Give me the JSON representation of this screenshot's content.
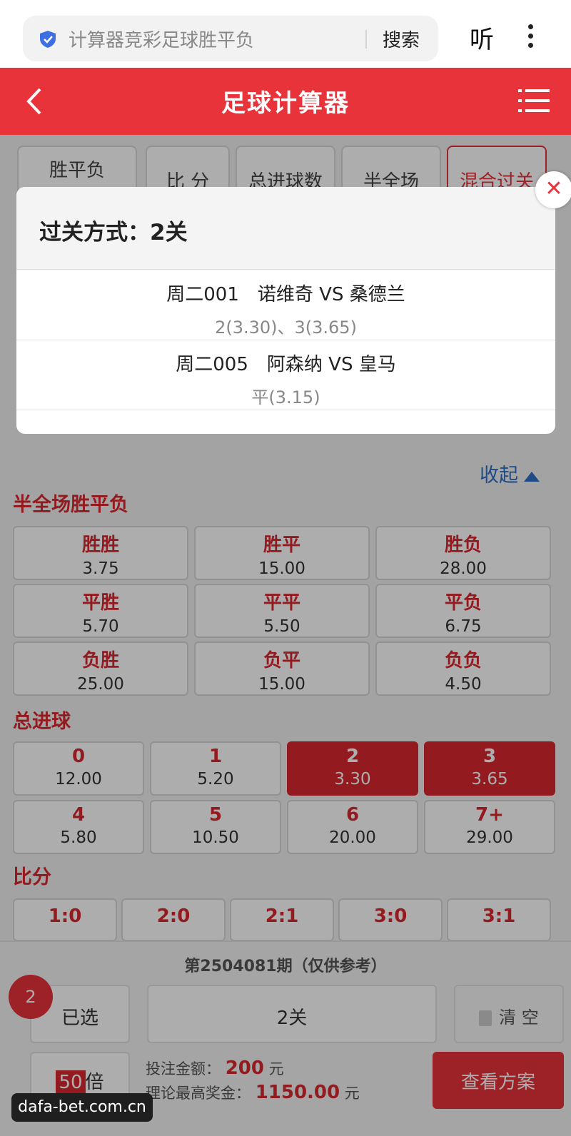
{
  "browser": {
    "search_text": "计算器竞彩足球胜平负",
    "search_btn": "搜索",
    "listen": "听"
  },
  "header": {
    "title": "足球计算器"
  },
  "tabs": [
    "胜平负",
    "比 分",
    "总进球数",
    "半全场",
    "混合过关"
  ],
  "collapse_label": "收起",
  "halffull": {
    "title": "半全场胜平负",
    "cells": [
      {
        "label": "胜胜",
        "odd": "3.75"
      },
      {
        "label": "胜平",
        "odd": "15.00"
      },
      {
        "label": "胜负",
        "odd": "28.00"
      },
      {
        "label": "平胜",
        "odd": "5.70"
      },
      {
        "label": "平平",
        "odd": "5.50"
      },
      {
        "label": "平负",
        "odd": "6.75"
      },
      {
        "label": "负胜",
        "odd": "25.00"
      },
      {
        "label": "负平",
        "odd": "15.00"
      },
      {
        "label": "负负",
        "odd": "4.50"
      }
    ]
  },
  "goals": {
    "title": "总进球",
    "cells": [
      {
        "label": "0",
        "odd": "12.00",
        "selected": false
      },
      {
        "label": "1",
        "odd": "5.20",
        "selected": false
      },
      {
        "label": "2",
        "odd": "3.30",
        "selected": true
      },
      {
        "label": "3",
        "odd": "3.65",
        "selected": true
      },
      {
        "label": "4",
        "odd": "5.80",
        "selected": false
      },
      {
        "label": "5",
        "odd": "10.50",
        "selected": false
      },
      {
        "label": "6",
        "odd": "20.00",
        "selected": false
      },
      {
        "label": "7+",
        "odd": "29.00",
        "selected": false
      }
    ]
  },
  "score": {
    "title": "比分",
    "cells": [
      "1:0",
      "2:0",
      "2:1",
      "3:0",
      "3:1"
    ]
  },
  "bottom": {
    "issue": "第2504081期（仅供参考）",
    "badge": "2",
    "selected_label": "已选",
    "pass_label": "2关",
    "clear_label": "清 空",
    "multiplier": "50",
    "multiplier_unit": "倍",
    "bet_label": "投注金额：",
    "bet_amount": "200",
    "prize_label": "理论最高奖金：",
    "prize_amount": "1150.00",
    "currency": "元",
    "view_label": "查看方案"
  },
  "popup": {
    "title": "过关方式：2关",
    "matches": [
      {
        "teams": "周二001　诺维奇 VS 桑德兰",
        "pick": "2(3.30)、3(3.65)"
      },
      {
        "teams": "周二005　阿森纳 VS 皇马",
        "pick": "平(3.15)"
      }
    ],
    "close": "✕"
  },
  "watermark": "dafa-bet.com.cn",
  "colors": {
    "accent": "#e8333a",
    "link": "#2d6fc4"
  }
}
